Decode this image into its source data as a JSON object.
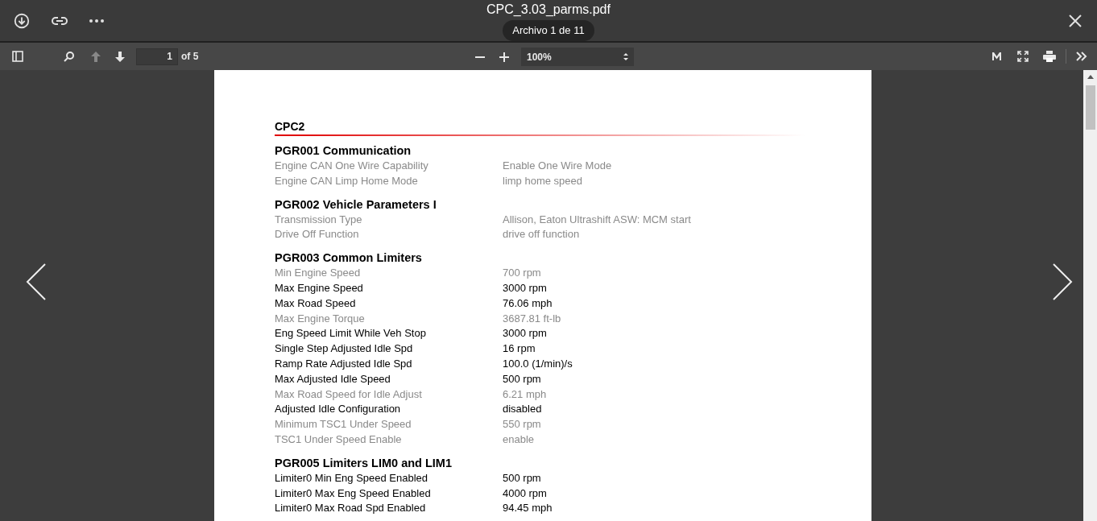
{
  "viewer": {
    "file_name": "CPC_3.03_parms.pdf",
    "file_counter": "Archivo 1 de 11"
  },
  "toolbar": {
    "previous_page_disabled": true,
    "next_page_disabled": false,
    "page_number": "1",
    "page_count": "of 5",
    "zoom": "100%"
  },
  "document": {
    "title": "CPC2",
    "sections": [
      {
        "heading": "PGR001 Communication",
        "rows": [
          {
            "label": "Engine CAN One Wire Capability",
            "value": "Enable One Wire Mode",
            "dimmed": true
          },
          {
            "label": "Engine CAN Limp Home Mode",
            "value": "limp home speed",
            "dimmed": true
          }
        ]
      },
      {
        "heading": "PGR002 Vehicle Parameters I",
        "rows": [
          {
            "label": "Transmission Type",
            "value": "Allison, Eaton Ultrashift ASW: MCM start",
            "dimmed": true
          },
          {
            "label": "Drive Off Function",
            "value": "drive off function",
            "dimmed": true
          }
        ]
      },
      {
        "heading": "PGR003 Common Limiters",
        "rows": [
          {
            "label": "Min Engine Speed",
            "value": "700 rpm",
            "dimmed": true
          },
          {
            "label": "Max Engine Speed",
            "value": "3000 rpm",
            "dimmed": false
          },
          {
            "label": "Max Road Speed",
            "value": "76.06 mph",
            "dimmed": false
          },
          {
            "label": "Max Engine Torque",
            "value": "3687.81 ft-lb",
            "dimmed": true
          },
          {
            "label": "Eng Speed Limit While Veh Stop",
            "value": "3000 rpm",
            "dimmed": false
          },
          {
            "label": "Single Step Adjusted Idle Spd",
            "value": "16 rpm",
            "dimmed": false
          },
          {
            "label": "Ramp Rate Adjusted Idle Spd",
            "value": "100.0 (1/min)/s",
            "dimmed": false
          },
          {
            "label": "Max Adjusted Idle Speed",
            "value": "500 rpm",
            "dimmed": false
          },
          {
            "label": "Max Road Speed for Idle Adjust",
            "value": "6.21 mph",
            "dimmed": true
          },
          {
            "label": "Adjusted Idle Configuration",
            "value": "disabled",
            "dimmed": false
          },
          {
            "label": "Minimum TSC1 Under Speed",
            "value": "550 rpm",
            "dimmed": true
          },
          {
            "label": "TSC1 Under Speed Enable",
            "value": "enable",
            "dimmed": true
          }
        ]
      },
      {
        "heading": "PGR005 Limiters LIM0 and LIM1",
        "rows": [
          {
            "label": "Limiter0 Min Eng Speed Enabled",
            "value": "500 rpm",
            "dimmed": false
          },
          {
            "label": "Limiter0 Max Eng Speed Enabled",
            "value": "4000 rpm",
            "dimmed": false
          },
          {
            "label": "Limiter0 Max Road Spd Enabled",
            "value": "94.45 mph",
            "dimmed": false
          }
        ]
      }
    ]
  }
}
